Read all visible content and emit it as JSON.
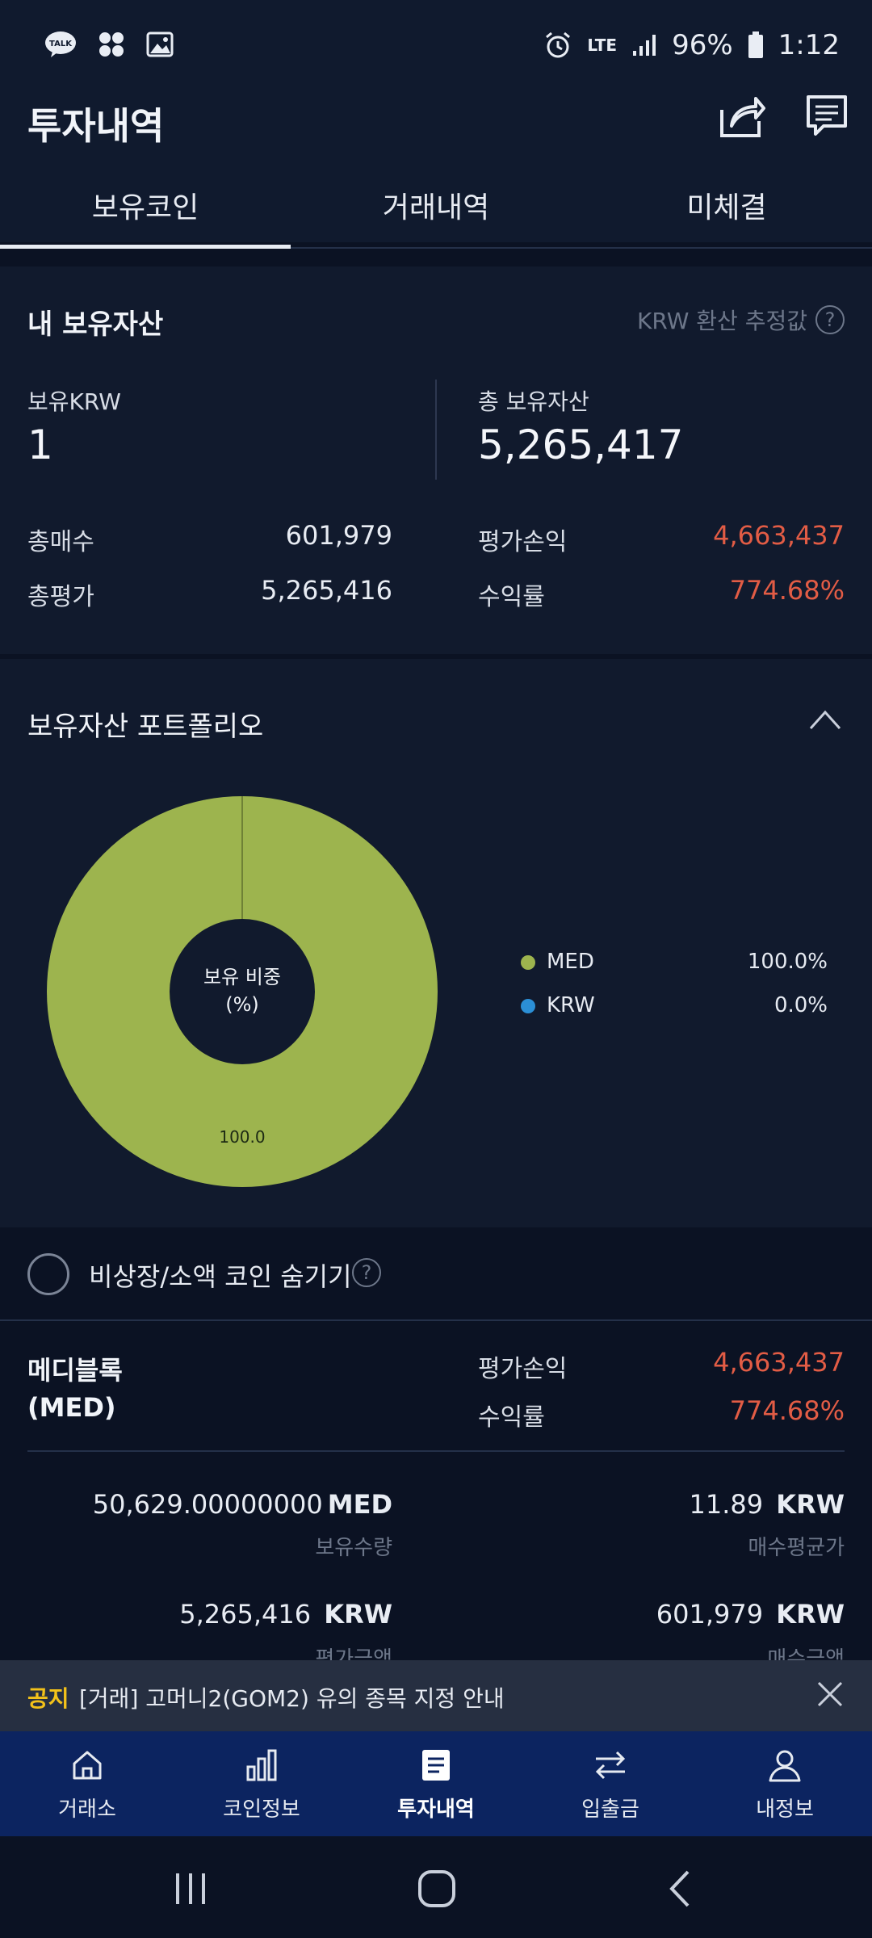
{
  "status_bar": {
    "left_icons": [
      "talk-icon",
      "apps-icon",
      "image-icon"
    ],
    "network": "LTE",
    "battery": "96%",
    "time": "1:12"
  },
  "app_bar": {
    "title": "투자내역",
    "icons": [
      "share-icon",
      "chat-icon"
    ]
  },
  "tabs": [
    {
      "label": "보유코인",
      "active": true
    },
    {
      "label": "거래내역",
      "active": false
    },
    {
      "label": "미체결",
      "active": false
    }
  ],
  "my_assets": {
    "title": "내 보유자산",
    "krw_note": "KRW 환산 추정값",
    "held_krw_label": "보유KRW",
    "held_krw_value": "1",
    "total_assets_label": "총 보유자산",
    "total_assets_value": "5,265,417",
    "total_buy_label": "총매수",
    "total_buy_value": "601,979",
    "total_eval_label": "총평가",
    "total_eval_value": "5,265,416",
    "pnl_label": "평가손익",
    "pnl_value": "4,663,437",
    "return_label": "수익률",
    "return_value": "774.68%"
  },
  "portfolio": {
    "title": "보유자산 포트폴리오",
    "center_label_1": "보유 비중",
    "center_label_2": "(%)",
    "slice_label": "100.0",
    "legend": [
      {
        "name": "MED",
        "value": "100.0%",
        "color": "#9db44e"
      },
      {
        "name": "KRW",
        "value": "0.0%",
        "color": "#2b8fd6"
      }
    ]
  },
  "chart_data": {
    "type": "pie",
    "categories": [
      "MED",
      "KRW"
    ],
    "values": [
      100.0,
      0.0
    ],
    "title": "보유 비중 (%)",
    "colors": [
      "#9db44e",
      "#2b8fd6"
    ]
  },
  "hide_option": {
    "label": "비상장/소액 코인 숨기기"
  },
  "holding": {
    "name": "메디블록",
    "symbol": "(MED)",
    "pnl_label": "평가손익",
    "pnl_value": "4,663,437",
    "return_label": "수익률",
    "return_value": "774.68%",
    "quantity_value": "50,629.00000000",
    "quantity_unit": "MED",
    "quantity_label": "보유수량",
    "avg_price_value": "11.89",
    "avg_price_unit": "KRW",
    "avg_price_label": "매수평균가",
    "eval_value": "5,265,416",
    "eval_unit": "KRW",
    "eval_label": "평가금액",
    "buy_value": "601,979",
    "buy_unit": "KRW",
    "buy_label": "매수금액"
  },
  "notice": {
    "tag": "공지",
    "text": "[거래] 고머니2(GOM2) 유의 종목 지정 안내"
  },
  "bottom_nav": [
    {
      "label": "거래소",
      "icon": "home-icon",
      "active": false
    },
    {
      "label": "코인정보",
      "icon": "bar-chart-icon",
      "active": false
    },
    {
      "label": "투자내역",
      "icon": "document-icon",
      "active": true
    },
    {
      "label": "입출금",
      "icon": "transfer-icon",
      "active": false
    },
    {
      "label": "내정보",
      "icon": "user-icon",
      "active": false
    }
  ]
}
